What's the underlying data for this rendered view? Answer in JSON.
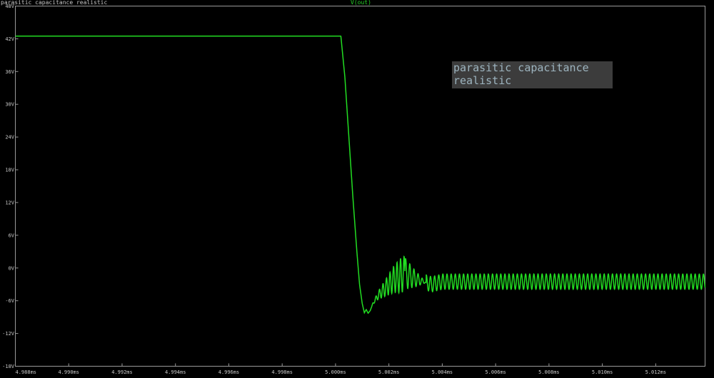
{
  "window": {
    "title": "parasitic capacitance realistic"
  },
  "chart_data": {
    "type": "line",
    "trace_label": "V(out)",
    "annotation": [
      "parasitic capacitance",
      "realistic"
    ],
    "y_ticks": [
      "48V",
      "42V",
      "36V",
      "30V",
      "24V",
      "18V",
      "12V",
      "6V",
      "0V",
      "-6V",
      "-12V",
      "-18V"
    ],
    "y_tick_values": [
      48,
      42,
      36,
      30,
      24,
      18,
      12,
      6,
      0,
      -6,
      -12,
      -18
    ],
    "x_ticks": [
      "4.988ms",
      "4.990ms",
      "4.992ms",
      "4.994ms",
      "4.996ms",
      "4.998ms",
      "5.000ms",
      "5.002ms",
      "5.004ms",
      "5.006ms",
      "5.008ms",
      "5.010ms",
      "5.012ms"
    ],
    "x_tick_values": [
      4.988,
      4.99,
      4.992,
      4.994,
      4.996,
      4.998,
      5.0,
      5.002,
      5.004,
      5.006,
      5.008,
      5.01,
      5.012
    ],
    "xlim": [
      4.988,
      5.01385
    ],
    "ylim": [
      -18,
      48
    ],
    "grid": false,
    "series": [
      {
        "color": "#22dd22",
        "x": [
          4.988,
          5.0002,
          5.00035,
          5.0005,
          5.00065,
          5.0008,
          5.0009,
          5.001,
          5.00108,
          5.00115,
          5.00122,
          5.0013,
          5.0014,
          5.0016,
          5.0018,
          5.002,
          5.0022,
          5.0024,
          5.0026,
          5.0028,
          5.003,
          5.0033,
          5.0036,
          5.004,
          5.005,
          5.006,
          5.007,
          5.008,
          5.009,
          5.01,
          5.011,
          5.012,
          5.01385
        ],
        "y": [
          42.5,
          42.5,
          35,
          24,
          13,
          3,
          -3,
          -6.5,
          -8.2,
          -7.6,
          -8.3,
          -7.8,
          -6.5,
          -5,
          -4,
          -3,
          -2,
          -1.5,
          -1,
          -1.5,
          -2,
          -2.5,
          -3,
          -2.5,
          -2.5,
          -2.5,
          -2.5,
          -2.5,
          -2.5,
          -2.5,
          -2.5,
          -2.5,
          -2.5
        ]
      }
    ],
    "ringing": {
      "start": 5.00135,
      "amplitude_early": 3.2,
      "amplitude_late": 1.4,
      "period_ms": 0.000155
    }
  }
}
